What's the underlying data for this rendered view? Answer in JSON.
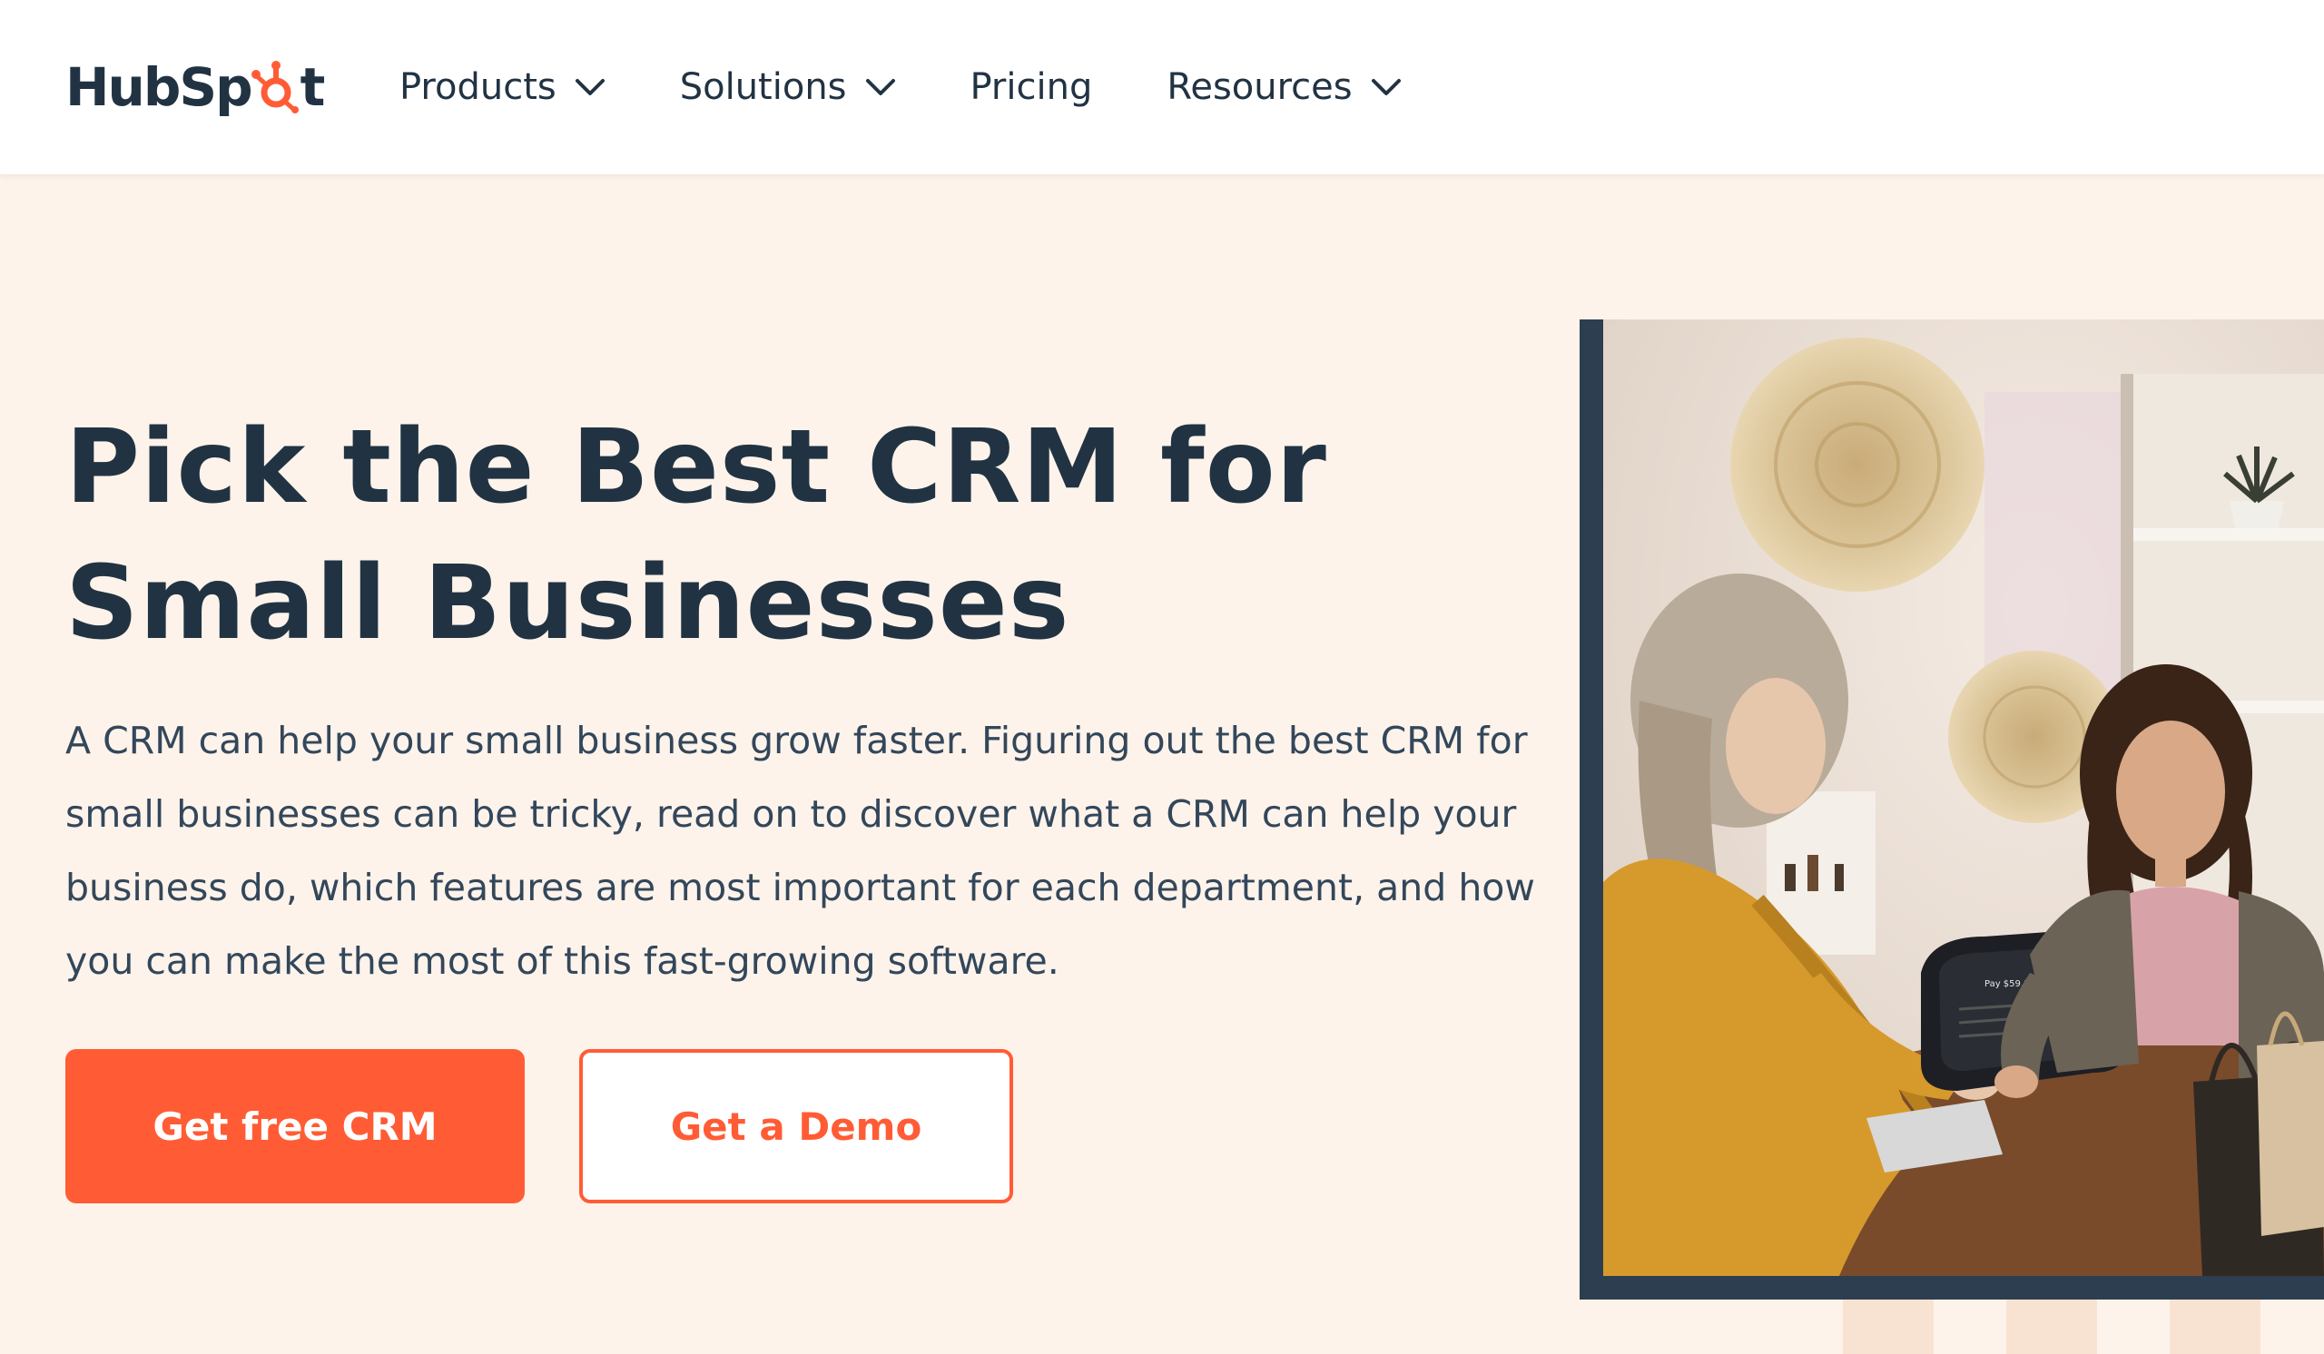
{
  "header": {
    "logo": {
      "text_left": "HubSp",
      "text_right": "t"
    },
    "nav": [
      {
        "label": "Products",
        "has_dropdown": true
      },
      {
        "label": "Solutions",
        "has_dropdown": true
      },
      {
        "label": "Pricing",
        "has_dropdown": false
      },
      {
        "label": "Resources",
        "has_dropdown": true
      }
    ]
  },
  "hero": {
    "title_line1": "Pick the Best CRM for",
    "title_line2": "Small Businesses",
    "description": "A CRM can help your small business grow faster. Figuring out the best CRM for small businesses can be tricky, read on to discover what a CRM can help your business do, which features are most important for each department, and how you can make the most of this fast-growing software.",
    "primary_button": "Get free CRM",
    "secondary_button": "Get a Demo"
  },
  "photo": {
    "payment_screen_text": "Pay $59.13"
  },
  "colors": {
    "brand_orange": "#ff5c35",
    "navy": "#213343",
    "hero_bg": "#fdf3ea",
    "frame": "#2d3e50"
  }
}
